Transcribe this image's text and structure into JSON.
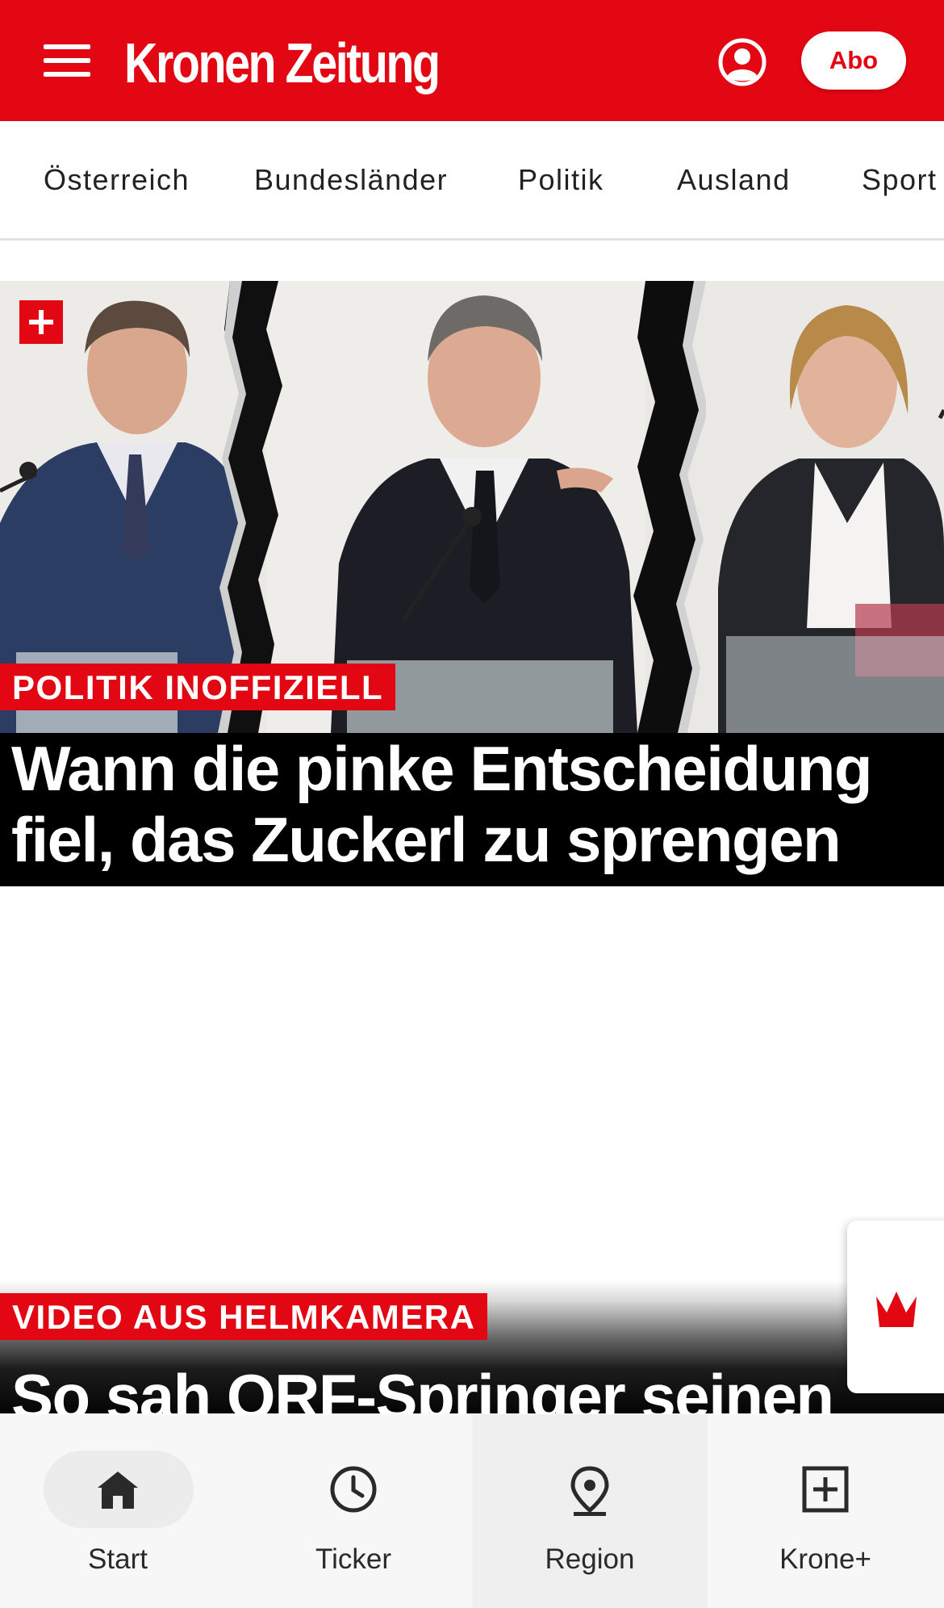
{
  "header": {
    "logo_text": "Kronen Zeitung",
    "abo_label": "Abo",
    "menu_icon": "hamburger-menu-icon",
    "account_icon": "user-circle-icon"
  },
  "categories": [
    "Österreich",
    "Bundesländer",
    "Politik",
    "Ausland",
    "Sport"
  ],
  "hero": {
    "kicker": "POLITIK INOFFIZIELL",
    "headline_line1": "Wann die pinke Entscheidung",
    "headline_line2": "fiel, das Zuckerl zu sprengen",
    "premium_icon": "plus-icon"
  },
  "article2": {
    "kicker": "VIDEO AUS HELMKAMERA",
    "headline_partial": "So sah ORF-Springer seinen"
  },
  "floating_tab": {
    "icon": "crown-icon"
  },
  "bottom_nav": [
    {
      "label": "Start",
      "icon": "home-icon",
      "active": true
    },
    {
      "label": "Ticker",
      "icon": "clock-icon",
      "active": false
    },
    {
      "label": "Region",
      "icon": "location-pin-icon",
      "active": false
    },
    {
      "label": "Krone+",
      "icon": "plus-square-icon",
      "active": false
    }
  ],
  "colors": {
    "brand_red": "#e30613",
    "header_text": "#ffffff",
    "nav_background": "#f7f7f7"
  }
}
